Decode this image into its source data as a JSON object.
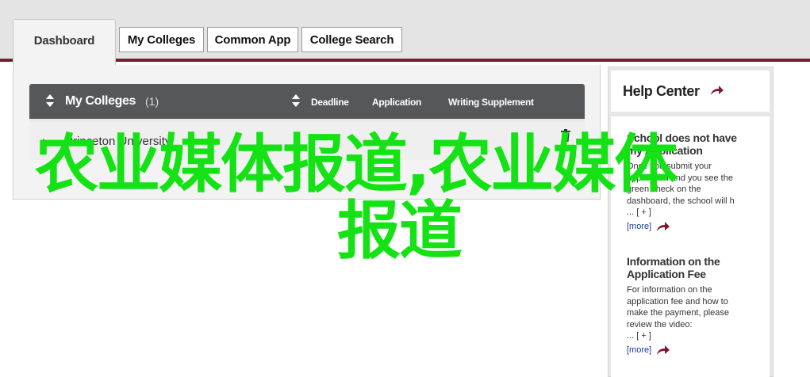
{
  "tabs": [
    {
      "label": "Dashboard",
      "active": true
    },
    {
      "label": "My Colleges",
      "active": false
    },
    {
      "label": "Common App",
      "active": false
    },
    {
      "label": "College Search",
      "active": false
    }
  ],
  "colleges": {
    "title": "My Colleges",
    "count": "(1)",
    "columns": {
      "deadline": "Deadline",
      "application": "Application",
      "writing_supplement": "Writing Supplement"
    },
    "rows": [
      {
        "name": "Princeton University"
      }
    ]
  },
  "help": {
    "title": "Help Center",
    "more_label": "[more]",
    "articles": [
      {
        "title_lines": [
          "School does not have",
          "my Application"
        ],
        "text_lines": [
          "Once you submit your",
          "application and you see the",
          "green check on the",
          "dashboard, the school will h",
          "... [ + ]"
        ]
      },
      {
        "title_lines": [
          "Information on the",
          "Application Fee"
        ],
        "text_lines": [
          "For information on the",
          "application fee and how to",
          "make the payment, please",
          "review the video:",
          "... [ + ]"
        ]
      }
    ]
  },
  "watermark": {
    "line1": "农业媒体报道,农业媒体",
    "line2": "报道"
  },
  "colors": {
    "accent_maroon": "#7b1c2e",
    "header_gray": "#555758",
    "watermark_green": "#14e214",
    "link_blue": "#1a3d8f"
  }
}
